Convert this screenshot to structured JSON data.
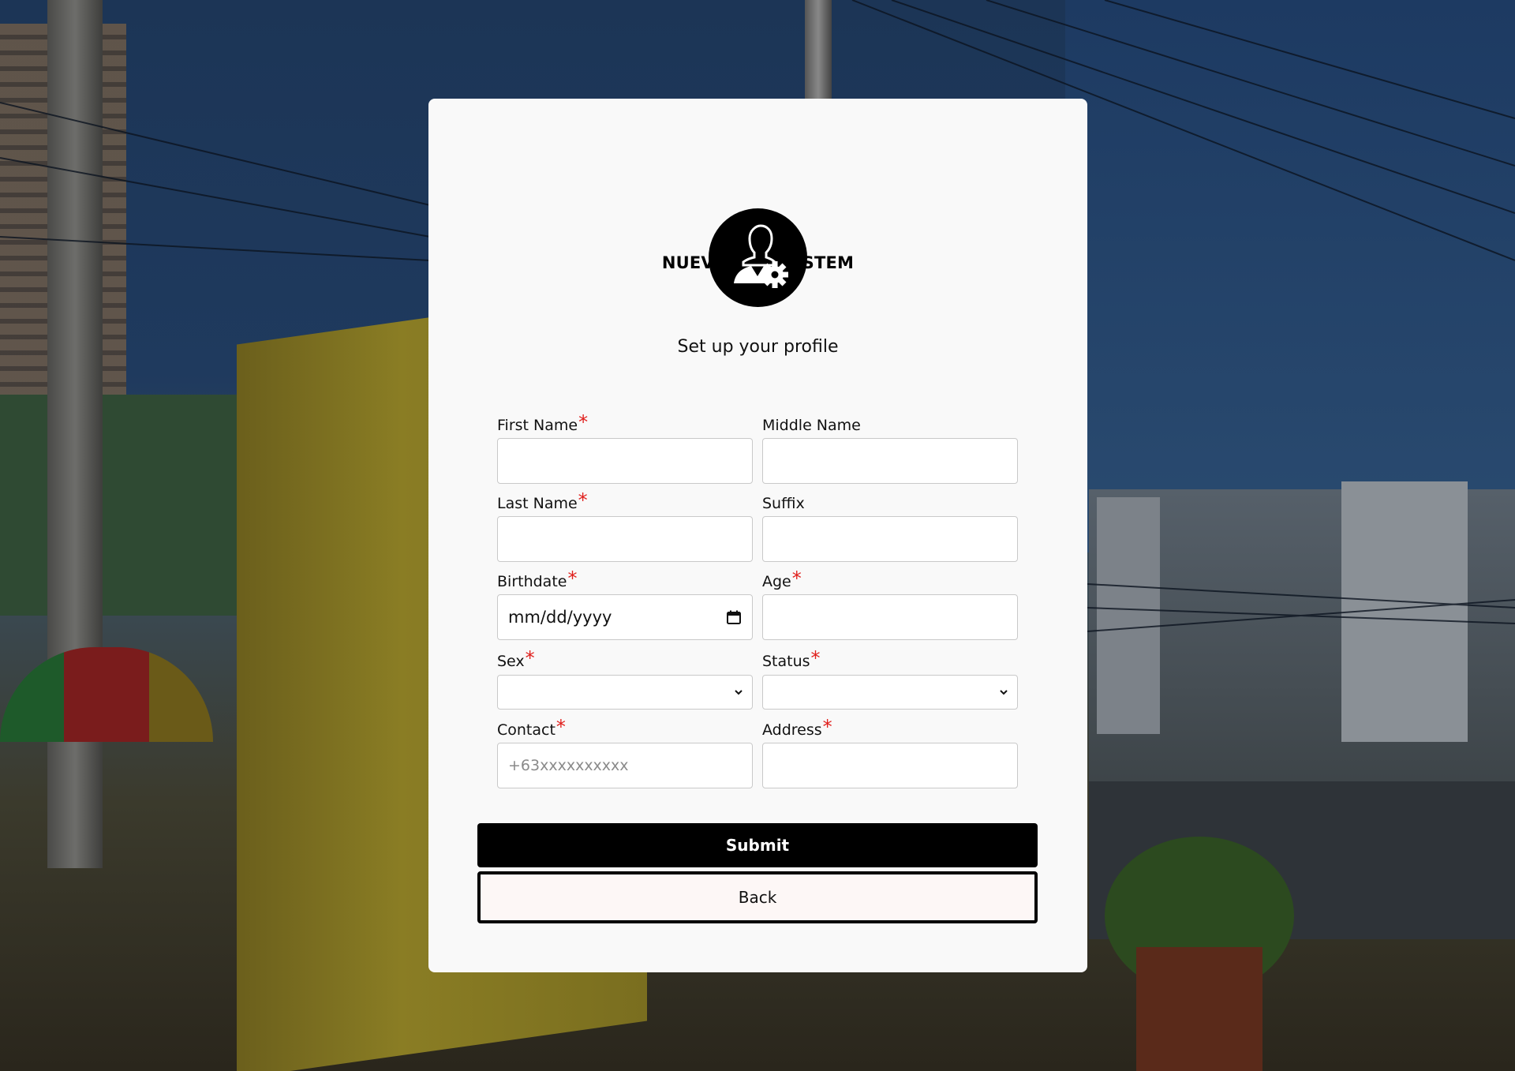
{
  "app": {
    "brand": "NUEVOLINK SYSTEM",
    "subtitle": "Set up your profile"
  },
  "icons": {
    "avatar": "user-gear-icon",
    "calendar": "calendar-icon",
    "dropdown": "chevron-down-icon"
  },
  "colors": {
    "card_background": "#f9f9f9",
    "required_marker": "#e0201d",
    "primary_button": "#000000",
    "secondary_button_bg": "#fdf7f6"
  },
  "form": {
    "required_marker": "*",
    "first_name": {
      "label": "First Name",
      "value": "",
      "placeholder": ""
    },
    "middle_name": {
      "label": "Middle Name",
      "value": "",
      "placeholder": ""
    },
    "last_name": {
      "label": "Last Name",
      "value": "",
      "placeholder": ""
    },
    "suffix": {
      "label": "Suffix",
      "value": "",
      "placeholder": ""
    },
    "birthdate": {
      "label": "Birthdate",
      "display": "mm/dd/yyyy"
    },
    "age": {
      "label": "Age",
      "value": "",
      "placeholder": ""
    },
    "sex": {
      "label": "Sex",
      "selected": ""
    },
    "status": {
      "label": "Status",
      "selected": ""
    },
    "contact": {
      "label": "Contact",
      "value": "",
      "placeholder": "+63xxxxxxxxxx"
    },
    "address": {
      "label": "Address",
      "value": "",
      "placeholder": ""
    }
  },
  "buttons": {
    "submit": "Submit",
    "back": "Back"
  }
}
